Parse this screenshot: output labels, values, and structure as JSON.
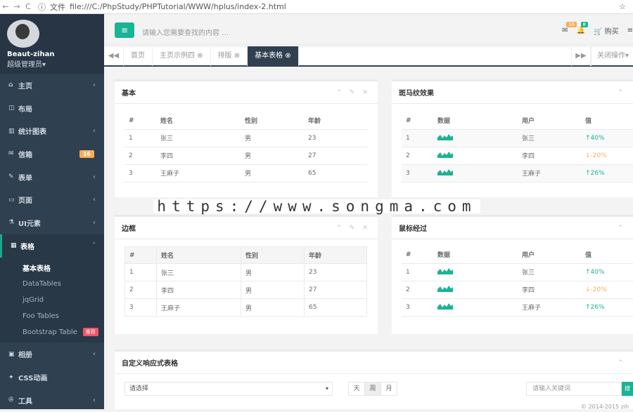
{
  "browser": {
    "back": "←",
    "forward": "→",
    "reload": "C",
    "file_label": "文件",
    "url": "file:///C:/PhpStudy/PHPTutorial/WWW/hplus/index-2.html",
    "star": "☆"
  },
  "profile": {
    "name": "Beaut-zihan",
    "role": "超级管理员▾"
  },
  "menu": [
    {
      "icon": "home-icon",
      "glyph": "⌂",
      "label": "主页",
      "arrow": "‹"
    },
    {
      "icon": "columns-icon",
      "glyph": "◫",
      "label": "布局",
      "arrow": ""
    },
    {
      "icon": "bar-chart-icon",
      "glyph": "▥",
      "label": "统计图表",
      "arrow": "‹"
    },
    {
      "icon": "envelope-icon",
      "glyph": "✉",
      "label": "信箱",
      "badge": "16"
    },
    {
      "icon": "edit-icon",
      "glyph": "✎",
      "label": "表单",
      "arrow": "‹"
    },
    {
      "icon": "desktop-icon",
      "glyph": "▭",
      "label": "页面",
      "arrow": "‹"
    },
    {
      "icon": "flask-icon",
      "glyph": "⚗",
      "label": "UI元素",
      "arrow": "‹"
    },
    {
      "icon": "table-icon",
      "glyph": "▦",
      "label": "表格",
      "arrow": "˅"
    }
  ],
  "submenu": [
    {
      "label": "基本表格"
    },
    {
      "label": "DataTables"
    },
    {
      "label": "jqGrid"
    },
    {
      "label": "Foo Tables"
    },
    {
      "label": "Bootstrap Table",
      "hot": "推荐"
    }
  ],
  "menu_after": [
    {
      "icon": "picture-icon",
      "glyph": "▣",
      "label": "相册",
      "arrow": "‹"
    },
    {
      "icon": "magic-icon",
      "glyph": "✦",
      "label": "CSS动画",
      "arrow": ""
    },
    {
      "icon": "tools-icon",
      "glyph": "✇",
      "label": "工具",
      "arrow": "‹"
    }
  ],
  "topbar": {
    "menu_glyph": "≡",
    "search_placeholder": "请输入您需要查找的内容 …",
    "mail_count": "16",
    "bell_count": "8",
    "buy_label": "购买",
    "colors": {
      "accent": "#1ab394",
      "warning": "#f8ac59",
      "danger": "#ed5565",
      "sidebar": "#2f4050"
    }
  },
  "tabs": {
    "prev": "◀◀",
    "items": [
      "首页",
      "主页示例四 ⊗",
      "排版 ⊗",
      "基本表格 ⊗"
    ],
    "next": "▶▶",
    "close_ops": "关闭操作▾"
  },
  "panels": {
    "basic": {
      "title": "基本",
      "headers": [
        "#",
        "姓名",
        "性别",
        "年龄"
      ],
      "rows": [
        [
          "1",
          "张三",
          "男",
          "23"
        ],
        [
          "2",
          "李四",
          "男",
          "27"
        ],
        [
          "3",
          "王麻子",
          "男",
          "65"
        ]
      ]
    },
    "zebra": {
      "title": "斑马纹效果",
      "headers": [
        "#",
        "数据",
        "用户",
        "值"
      ],
      "rows": [
        [
          "1",
          "",
          "张三",
          "↑40%"
        ],
        [
          "2",
          "",
          "李四",
          "↓-20%"
        ],
        [
          "3",
          "",
          "王麻子",
          "↑26%"
        ]
      ]
    },
    "bordered": {
      "title": "边框",
      "headers": [
        "#",
        "姓名",
        "性别",
        "年龄"
      ],
      "rows": [
        [
          "1",
          "张三",
          "男",
          "23"
        ],
        [
          "2",
          "李四",
          "男",
          "27"
        ],
        [
          "3",
          "王麻子",
          "男",
          "65"
        ]
      ]
    },
    "hover": {
      "title": "鼠标经过",
      "headers": [
        "#",
        "数据",
        "用户",
        "值"
      ],
      "rows": [
        [
          "1",
          "",
          "张三",
          "↑40%"
        ],
        [
          "2",
          "",
          "李四",
          "↓-20%"
        ],
        [
          "3",
          "",
          "王麻子",
          "↑26%"
        ]
      ]
    },
    "custom": {
      "title": "自定义响应式表格",
      "select": "请选择",
      "seg": [
        "天",
        "周",
        "月"
      ],
      "kw": "请输入关键词",
      "go": "搜"
    }
  },
  "tools": "⌃ ✎ ✕",
  "watermark": "https://www.songma.com",
  "footer": "© 2014-2015 zih"
}
